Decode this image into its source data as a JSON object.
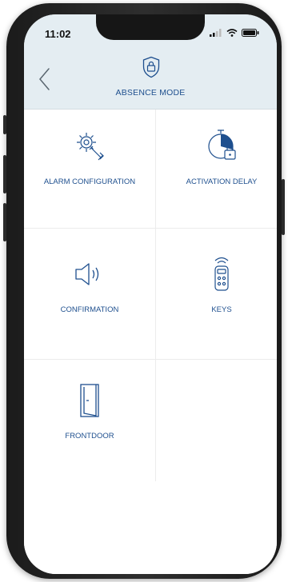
{
  "status_bar": {
    "time": "11:02",
    "icons": [
      "signal-icon",
      "wifi-icon",
      "battery-icon"
    ]
  },
  "header": {
    "title": "ABSENCE MODE",
    "icon": "shield-lock-icon",
    "back_icon": "chevron-left-icon"
  },
  "menu": {
    "items": [
      {
        "label": "ALARM CONFIGURATION",
        "icon": "gear-wrench-icon"
      },
      {
        "label": "ACTIVATION DELAY",
        "icon": "stopwatch-lock-icon"
      },
      {
        "label": "CONFIRMATION",
        "icon": "speaker-icon"
      },
      {
        "label": "KEYS",
        "icon": "remote-key-icon"
      },
      {
        "label": "FRONTDOOR",
        "icon": "door-icon"
      }
    ]
  },
  "colors": {
    "accent": "#1e4f8e",
    "header_bg": "#e4edf2",
    "grid_line": "#ececec",
    "phone_frame": "#1b1b1b"
  }
}
